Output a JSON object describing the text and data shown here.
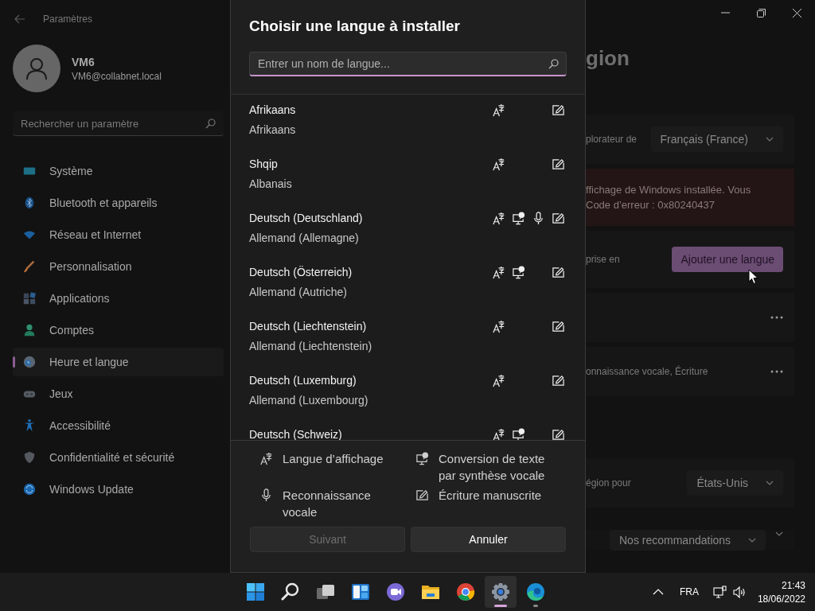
{
  "window": {
    "title": "Paramètres"
  },
  "account": {
    "name": "VM6",
    "email": "VM6@collabnet.local"
  },
  "search": {
    "placeholder": "Rechercher un paramètre"
  },
  "nav": [
    {
      "label": "Système",
      "kind": "system",
      "selected": false
    },
    {
      "label": "Bluetooth et appareils",
      "kind": "bluetooth",
      "selected": false
    },
    {
      "label": "Réseau et Internet",
      "kind": "network",
      "selected": false
    },
    {
      "label": "Personnalisation",
      "kind": "brush",
      "selected": false
    },
    {
      "label": "Applications",
      "kind": "apps",
      "selected": false
    },
    {
      "label": "Comptes",
      "kind": "accounts",
      "selected": false
    },
    {
      "label": "Heure et langue",
      "kind": "time",
      "selected": true
    },
    {
      "label": "Jeux",
      "kind": "gaming",
      "selected": false
    },
    {
      "label": "Accessibilité",
      "kind": "accessibility",
      "selected": false
    },
    {
      "label": "Confidentialité et sécurité",
      "kind": "shield",
      "selected": false
    },
    {
      "label": "Windows Update",
      "kind": "update",
      "selected": false
    }
  ],
  "content": {
    "title": "gion",
    "groups": [
      {
        "rows": [
          {
            "kind": "dropdown",
            "label": "plorateur de",
            "value": "Français (France)"
          },
          {
            "kind": "error",
            "lines": [
              "ffichage de Windows installée. Vous",
              "Code d’erreur : 0x80240437"
            ]
          },
          {
            "kind": "button",
            "label": "prise en",
            "button": "Ajouter une langue"
          },
          {
            "kind": "more"
          },
          {
            "kind": "more",
            "label": "onnaissance vocale, Écriture"
          }
        ]
      },
      {
        "rows": [
          {
            "kind": "dropdown",
            "label": "égion pour",
            "value": "États-Unis"
          },
          {
            "kind": "split",
            "value": "Nos recommandations"
          }
        ]
      }
    ]
  },
  "dialog": {
    "title": "Choisir une langue à installer",
    "search_placeholder": "Entrer un nom de langue...",
    "languages": [
      {
        "name": "Afrikaans",
        "subtitle": "Afrikaans",
        "display": true,
        "tts": false,
        "speech": false,
        "handwriting": true
      },
      {
        "name": "Shqip",
        "subtitle": "Albanais",
        "display": true,
        "tts": false,
        "speech": false,
        "handwriting": true
      },
      {
        "name": "Deutsch (Deutschland)",
        "subtitle": "Allemand (Allemagne)",
        "display": true,
        "tts": true,
        "speech": true,
        "handwriting": true
      },
      {
        "name": "Deutsch (Österreich)",
        "subtitle": "Allemand (Autriche)",
        "display": true,
        "tts": true,
        "speech": false,
        "handwriting": true
      },
      {
        "name": "Deutsch (Liechtenstein)",
        "subtitle": "Allemand (Liechtenstein)",
        "display": true,
        "tts": false,
        "speech": false,
        "handwriting": true
      },
      {
        "name": "Deutsch (Luxemburg)",
        "subtitle": "Allemand (Luxembourg)",
        "display": true,
        "tts": false,
        "speech": false,
        "handwriting": true
      },
      {
        "name": "Deutsch (Schweiz)",
        "display": true,
        "tts": true,
        "speech": false,
        "handwriting": true
      }
    ],
    "legend": [
      {
        "kind": "display",
        "label": "Langue d’affichage"
      },
      {
        "kind": "tts",
        "label": "Conversion de texte par synthèse vocale"
      },
      {
        "kind": "speech",
        "label": "Reconnaissance vocale"
      },
      {
        "kind": "handwriting",
        "label": "Écriture manuscrite"
      }
    ],
    "buttons": [
      {
        "label": "Suivant",
        "disabled": true
      },
      {
        "label": "Annuler",
        "disabled": false
      }
    ]
  },
  "taskbar": {
    "apps": [
      {
        "kind": "start",
        "selected": false,
        "running": false
      },
      {
        "kind": "search",
        "selected": false,
        "running": false
      },
      {
        "kind": "taskview",
        "selected": false,
        "running": false
      },
      {
        "kind": "widgets",
        "selected": false,
        "running": false
      },
      {
        "kind": "chat",
        "selected": false,
        "running": false
      },
      {
        "kind": "explorer",
        "selected": false,
        "running": false
      },
      {
        "kind": "chrome",
        "selected": false,
        "running": false
      },
      {
        "kind": "settings",
        "selected": true,
        "running": true
      },
      {
        "kind": "edge",
        "selected": false,
        "running": true
      }
    ],
    "language": "FRA",
    "time": "21:43",
    "date": "18/06/2022"
  }
}
